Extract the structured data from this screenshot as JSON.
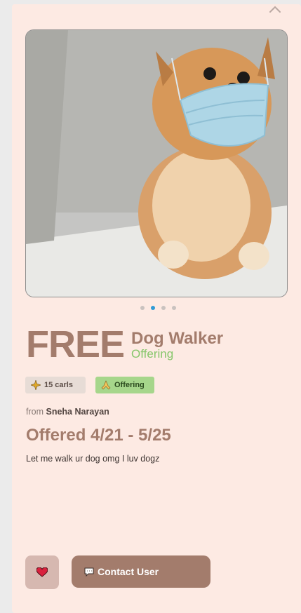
{
  "listing": {
    "price": "FREE",
    "title": "Dog Walker",
    "type_label": "Offering",
    "carls_badge": "15 carls",
    "offering_badge": "Offering",
    "from_prefix": "from",
    "user_name": "Sneha Narayan",
    "offered_dates": "Offered 4/21 - 5/25",
    "description": "Let me walk ur dog omg I luv dogz"
  },
  "actions": {
    "contact_label": "Contact User"
  },
  "carousel": {
    "total": 4,
    "active_index": 2
  },
  "colors": {
    "brand": "#a37c6c",
    "background": "#fdeae3",
    "offering_green": "#86c66a",
    "dot_active": "#2f9bd6"
  },
  "icons": {
    "collapse": "chevron-up-icon",
    "carls": "sparkle-icon",
    "offering": "praying-hands-icon",
    "favorite": "heart-icon",
    "contact": "chat-bubble-icon"
  }
}
